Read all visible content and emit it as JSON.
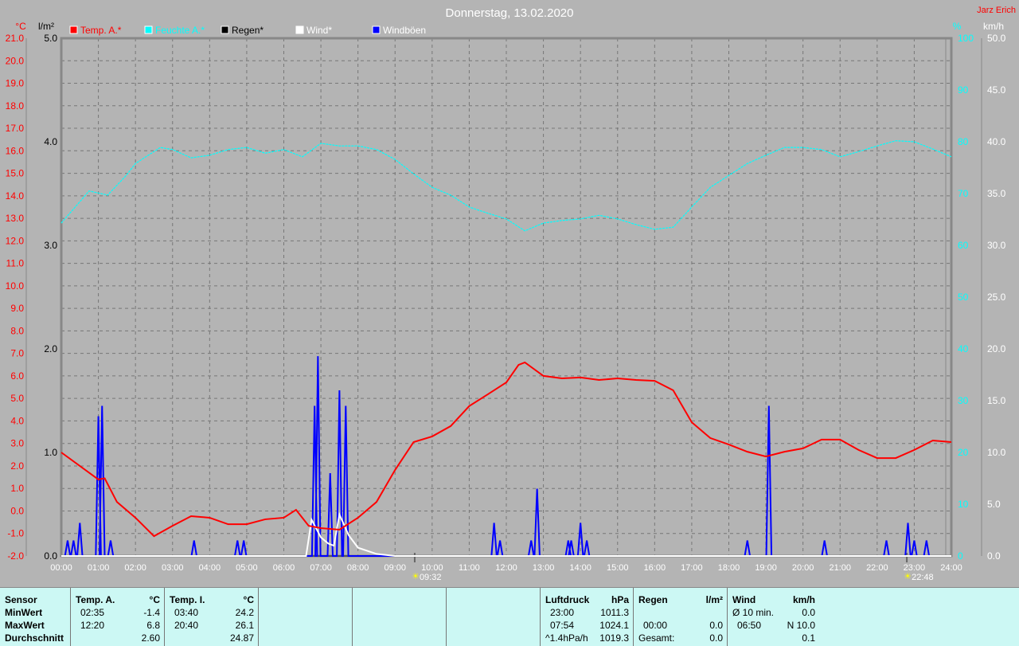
{
  "header": {
    "title": "Donnerstag, 13.02.2020",
    "author": "Jarz Erich"
  },
  "colors": {
    "temp": "#ff0000",
    "humidity": "#00ffff",
    "rain": "#000000",
    "wind": "#ffffff",
    "gust": "#0000ff"
  },
  "chart_data": {
    "type": "line",
    "title": "Donnerstag, 13.02.2020",
    "legend": [
      "Temp. A.*",
      "Feuchte A.*",
      "Regen*",
      "Wind*",
      "Windböen"
    ],
    "legend_placement": "top-left",
    "axes": {
      "temp": {
        "unit": "°C",
        "range": [
          -2,
          21
        ],
        "ticks": [
          "-2.0",
          "-1.0",
          "0.0",
          "1.0",
          "2.0",
          "3.0",
          "4.0",
          "5.0",
          "6.0",
          "7.0",
          "8.0",
          "9.0",
          "10.0",
          "11.0",
          "12.0",
          "13.0",
          "14.0",
          "15.0",
          "16.0",
          "17.0",
          "18.0",
          "19.0",
          "20.0",
          "21.0"
        ]
      },
      "rain": {
        "unit": "l/m²",
        "range": [
          0,
          5
        ],
        "ticks": [
          "0.0",
          "1.0",
          "2.0",
          "3.0",
          "4.0",
          "5.0"
        ]
      },
      "humidity": {
        "unit": "%",
        "range": [
          0,
          100
        ],
        "ticks": [
          "0",
          "10",
          "20",
          "30",
          "40",
          "50",
          "60",
          "70",
          "80",
          "90",
          "100"
        ]
      },
      "wind": {
        "unit": "km/h",
        "range": [
          0,
          50
        ],
        "ticks": [
          "0.0",
          "5.0",
          "10.0",
          "15.0",
          "20.0",
          "25.0",
          "30.0",
          "35.0",
          "40.0",
          "45.0",
          "50.0"
        ]
      },
      "x": {
        "range": [
          0,
          24
        ],
        "ticks": [
          "00:00",
          "01:00",
          "02:00",
          "03:00",
          "04:00",
          "05:00",
          "06:00",
          "07:00",
          "08:00",
          "09:00",
          "10:00",
          "11:00",
          "12:00",
          "13:00",
          "14:00",
          "15:00",
          "16:00",
          "17:00",
          "18:00",
          "19:00",
          "20:00",
          "21:00",
          "22:00",
          "23:00",
          "24:00"
        ]
      }
    },
    "grid": true,
    "markers": [
      {
        "label": "09:32",
        "time": 9.53
      },
      {
        "label": "22:48",
        "time": 22.8
      }
    ],
    "series": [
      {
        "name": "Temp. A.*",
        "axis": "temp",
        "x": [
          0,
          1,
          1.17,
          1.5,
          2,
          2.5,
          3,
          3.5,
          4,
          4.5,
          5,
          5.5,
          6,
          6.33,
          6.67,
          7,
          7.5,
          8,
          8.5,
          9,
          9.5,
          10,
          10.5,
          11,
          11.5,
          12,
          12.33,
          12.5,
          13,
          13.5,
          14,
          14.5,
          15,
          15.5,
          16,
          16.5,
          17,
          17.5,
          18,
          18.5,
          19,
          19.5,
          20,
          20.5,
          21,
          21.5,
          22,
          22.5,
          23,
          23.5,
          24
        ],
        "y": [
          2.6,
          1.4,
          1.45,
          0.4,
          -0.3,
          -1.12,
          -0.66,
          -0.23,
          -0.3,
          -0.59,
          -0.59,
          -0.37,
          -0.3,
          0.05,
          -0.66,
          -0.76,
          -0.83,
          -0.3,
          0.4,
          1.82,
          3.06,
          3.31,
          3.77,
          4.66,
          5.18,
          5.71,
          6.49,
          6.6,
          6.0,
          5.89,
          5.93,
          5.82,
          5.89,
          5.82,
          5.78,
          5.36,
          3.94,
          3.24,
          2.95,
          2.63,
          2.42,
          2.63,
          2.78,
          3.17,
          3.17,
          2.71,
          2.35,
          2.35,
          2.71,
          3.13,
          3.06
        ]
      },
      {
        "name": "Feuchte A.*",
        "axis": "humidity",
        "x": [
          0,
          0.75,
          1.25,
          1.75,
          2,
          2.67,
          3,
          3.5,
          4,
          4.5,
          5,
          5.5,
          6,
          6.5,
          7,
          7.5,
          8,
          8.5,
          9,
          9.5,
          10,
          10.5,
          11,
          11.5,
          12,
          12.5,
          13,
          13.5,
          14,
          14.5,
          15,
          15.5,
          16,
          16.5,
          17,
          17.5,
          18,
          18.5,
          19,
          19.5,
          20,
          20.5,
          21,
          21.5,
          22,
          22.5,
          23,
          23.5,
          24
        ],
        "y": [
          64.3,
          70.5,
          69.7,
          73.5,
          75.8,
          78.9,
          78.5,
          76.9,
          77.4,
          78.5,
          78.9,
          77.8,
          78.5,
          77.1,
          79.7,
          79.2,
          79.2,
          78.5,
          76.6,
          73.8,
          71.2,
          69.7,
          67.4,
          66.2,
          65.1,
          62.8,
          64.3,
          64.8,
          65.1,
          65.8,
          65.1,
          64.0,
          63.1,
          63.5,
          67.4,
          71.2,
          73.5,
          75.8,
          77.4,
          78.9,
          78.9,
          78.5,
          77.1,
          78.1,
          79.2,
          80.2,
          80.0,
          78.6,
          77.1
        ]
      },
      {
        "name": "Regen*",
        "axis": "rain",
        "x": [
          0,
          24
        ],
        "y": [
          0,
          0
        ]
      },
      {
        "name": "Wind*",
        "axis": "wind",
        "x": [
          0,
          6.6,
          6.75,
          7,
          7.2,
          7.35,
          7.5,
          7.75,
          8,
          8.5,
          9,
          24
        ],
        "y": [
          0,
          0,
          3.5,
          1.8,
          1.2,
          1,
          4,
          2,
          0.8,
          0.2,
          0,
          0
        ]
      },
      {
        "name": "Windböen",
        "axis": "wind",
        "spikes": true,
        "x": [
          0.17,
          0.33,
          0.5,
          1.0,
          1.1,
          1.33,
          3.58,
          4.75,
          4.92,
          6.83,
          6.92,
          7.25,
          7.5,
          7.67,
          11.67,
          11.83,
          12.67,
          12.83,
          13.67,
          13.75,
          14.0,
          14.17,
          18.5,
          19.08,
          20.58,
          22.25,
          22.83,
          23.0,
          23.33
        ],
        "y": [
          1.5,
          1.5,
          3.2,
          13.5,
          14.5,
          1.5,
          1.5,
          1.5,
          1.5,
          14.5,
          19.3,
          8,
          16,
          14.5,
          3.2,
          1.5,
          1.5,
          6.5,
          1.5,
          1.5,
          3.2,
          1.5,
          1.5,
          14.5,
          1.5,
          1.5,
          3.2,
          1.5,
          1.5
        ]
      }
    ]
  },
  "stats": {
    "temp_a": {
      "sensor": "Sensor",
      "min_label": "MinWert",
      "max_label": "MaxWert",
      "avg_label": "Durchschnitt",
      "title": "Temp. A.",
      "unit": "°C",
      "min_time": "02:35",
      "min": "-1.4",
      "max_time": "12:20",
      "max": "6.8",
      "avg": "2.60"
    },
    "temp_i": {
      "title": "Temp. I.",
      "unit": "°C",
      "min_time": "03:40",
      "min": "24.2",
      "max_time": "20:40",
      "max": "26.1",
      "avg": "24.87"
    },
    "pressure": {
      "title": "Luftdruck",
      "unit": "hPa",
      "t1": "23:00",
      "v1": "1011.3",
      "t2": "07:54",
      "v2": "1024.1",
      "t3": "^1.4hPa/h",
      "v3": "1019.3"
    },
    "rain": {
      "title": "Regen",
      "unit": "l/m²",
      "t2": "00:00",
      "v2": "0.0",
      "t3": "Gesamt:",
      "v3": "0.0"
    },
    "wind": {
      "title": "Wind",
      "unit": "km/h",
      "t1": "Ø 10 min.",
      "v1": "0.0",
      "t2": "06:50",
      "v2": "N 10.0",
      "v3": "0.1"
    }
  }
}
